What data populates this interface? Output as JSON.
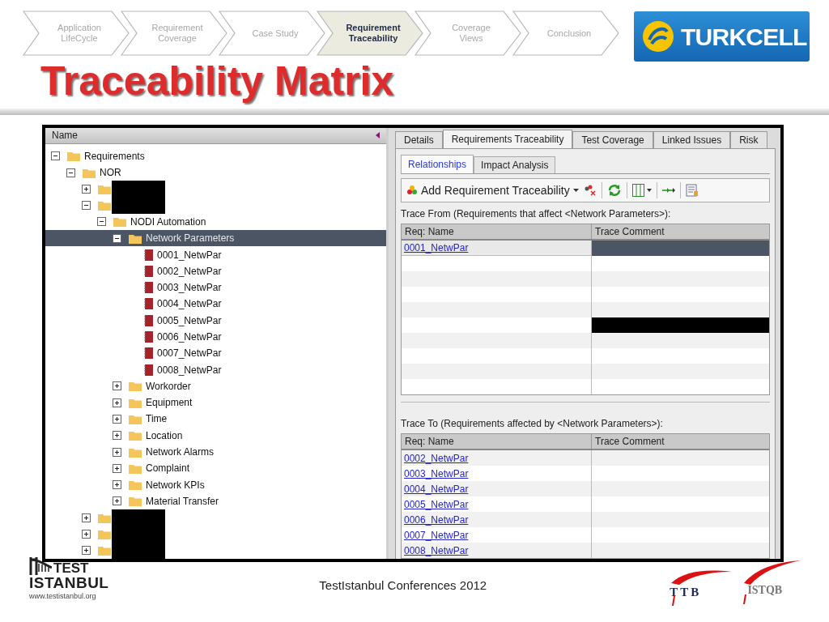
{
  "breadcrumb": [
    {
      "label": "Application\nLifeCycle",
      "selected": false
    },
    {
      "label": "Requirement\nCoverage",
      "selected": false
    },
    {
      "label": "Case Study",
      "selected": false
    },
    {
      "label": "Requirement\nTraceability",
      "selected": true
    },
    {
      "label": "Coverage\nViews",
      "selected": false
    },
    {
      "label": "Conclusion",
      "selected": false
    }
  ],
  "brand": {
    "name": "TURKCELL"
  },
  "title": "Traceability Matrix",
  "tree": {
    "header": "Name",
    "items": [
      {
        "kind": "folder",
        "label": "Requirements",
        "expanded": true,
        "selected": false,
        "children": [
          {
            "kind": "folder",
            "label": "NOR",
            "expanded": true,
            "selected": false,
            "children": [
              {
                "kind": "redacted",
                "expanded": false
              },
              {
                "kind": "redacted",
                "expanded": true,
                "children": [
                  {
                    "kind": "folder",
                    "label": "NODI Automation",
                    "expanded": true,
                    "selected": false,
                    "children": [
                      {
                        "kind": "folder",
                        "label": "Network Parameters",
                        "expanded": true,
                        "selected": true,
                        "children": [
                          {
                            "kind": "requirement",
                            "label": "0001_NetwPar",
                            "selected": false
                          },
                          {
                            "kind": "requirement",
                            "label": "0002_NetwPar",
                            "selected": false
                          },
                          {
                            "kind": "requirement",
                            "label": "0003_NetwPar",
                            "selected": false
                          },
                          {
                            "kind": "requirement",
                            "label": "0004_NetwPar",
                            "selected": false
                          },
                          {
                            "kind": "requirement",
                            "label": "0005_NetwPar",
                            "selected": false
                          },
                          {
                            "kind": "requirement",
                            "label": "0006_NetwPar",
                            "selected": false
                          },
                          {
                            "kind": "requirement",
                            "label": "0007_NetwPar",
                            "selected": false
                          },
                          {
                            "kind": "requirement",
                            "label": "0008_NetwPar",
                            "selected": false
                          }
                        ]
                      },
                      {
                        "kind": "folder",
                        "label": "Workorder",
                        "expanded": false,
                        "selected": false
                      },
                      {
                        "kind": "folder",
                        "label": "Equipment",
                        "expanded": false,
                        "selected": false
                      },
                      {
                        "kind": "folder",
                        "label": "Time",
                        "expanded": false,
                        "selected": false
                      },
                      {
                        "kind": "folder",
                        "label": "Location",
                        "expanded": false,
                        "selected": false
                      },
                      {
                        "kind": "folder",
                        "label": "Network Alarms",
                        "expanded": false,
                        "selected": false
                      },
                      {
                        "kind": "folder",
                        "label": "Complaint",
                        "expanded": false,
                        "selected": false
                      },
                      {
                        "kind": "folder",
                        "label": "Network KPIs",
                        "expanded": false,
                        "selected": false
                      },
                      {
                        "kind": "folder",
                        "label": "Material Transfer",
                        "expanded": false,
                        "selected": false
                      }
                    ]
                  }
                ]
              },
              {
                "kind": "redacted",
                "expanded": false
              },
              {
                "kind": "redacted",
                "expanded": false
              },
              {
                "kind": "redacted",
                "expanded": false
              }
            ]
          }
        ]
      }
    ]
  },
  "tabs": [
    {
      "label": "Details",
      "selected": false
    },
    {
      "label": "Requirements Traceability",
      "selected": true
    },
    {
      "label": "Test Coverage",
      "selected": false
    },
    {
      "label": "Linked Issues",
      "selected": false
    },
    {
      "label": "Risk",
      "selected": false
    }
  ],
  "subtabs": [
    {
      "label": "Relationships",
      "selected": true
    },
    {
      "label": "Impact Analysis",
      "selected": false
    }
  ],
  "toolbar": {
    "add_label": "Add Requirement Traceability"
  },
  "trace_from": {
    "label": "Trace From (Requirements that affect <Network Parameters>):",
    "columns": [
      "Req: Name",
      "Trace Comment"
    ],
    "rows": [
      {
        "name": "0001_NetwPar",
        "selected": true,
        "redacted": false
      },
      {
        "selected": false,
        "redacted": false
      },
      {
        "selected": false,
        "redacted": false
      },
      {
        "selected": false,
        "redacted": false
      },
      {
        "selected": false,
        "redacted": false
      },
      {
        "selected": false,
        "redacted": true
      },
      {
        "selected": false,
        "redacted": false
      },
      {
        "selected": false,
        "redacted": false
      },
      {
        "selected": false,
        "redacted": false
      },
      {
        "selected": false,
        "redacted": false
      }
    ]
  },
  "trace_to": {
    "label": "Trace To (Requirements affected by <Network Parameters>):",
    "columns": [
      "Req: Name",
      "Trace Comment"
    ],
    "rows": [
      {
        "name": "0002_NetwPar",
        "selected": false
      },
      {
        "name": "0003_NetwPar",
        "selected": false
      },
      {
        "name": "0004_NetwPar",
        "selected": false
      },
      {
        "name": "0005_NetwPar",
        "selected": false
      },
      {
        "name": "0006_NetwPar",
        "selected": false
      },
      {
        "name": "0007_NetwPar",
        "selected": false
      },
      {
        "name": "0008_NetwPar",
        "selected": false
      }
    ]
  },
  "footer": {
    "logo_top": "TEST",
    "logo_bottom": "ISTANBUL",
    "url": "www.testistanbul.org",
    "caption": "TestIstanbul Conferences 2012",
    "partner_1": "TTB",
    "partner_2": "ISTQB"
  }
}
